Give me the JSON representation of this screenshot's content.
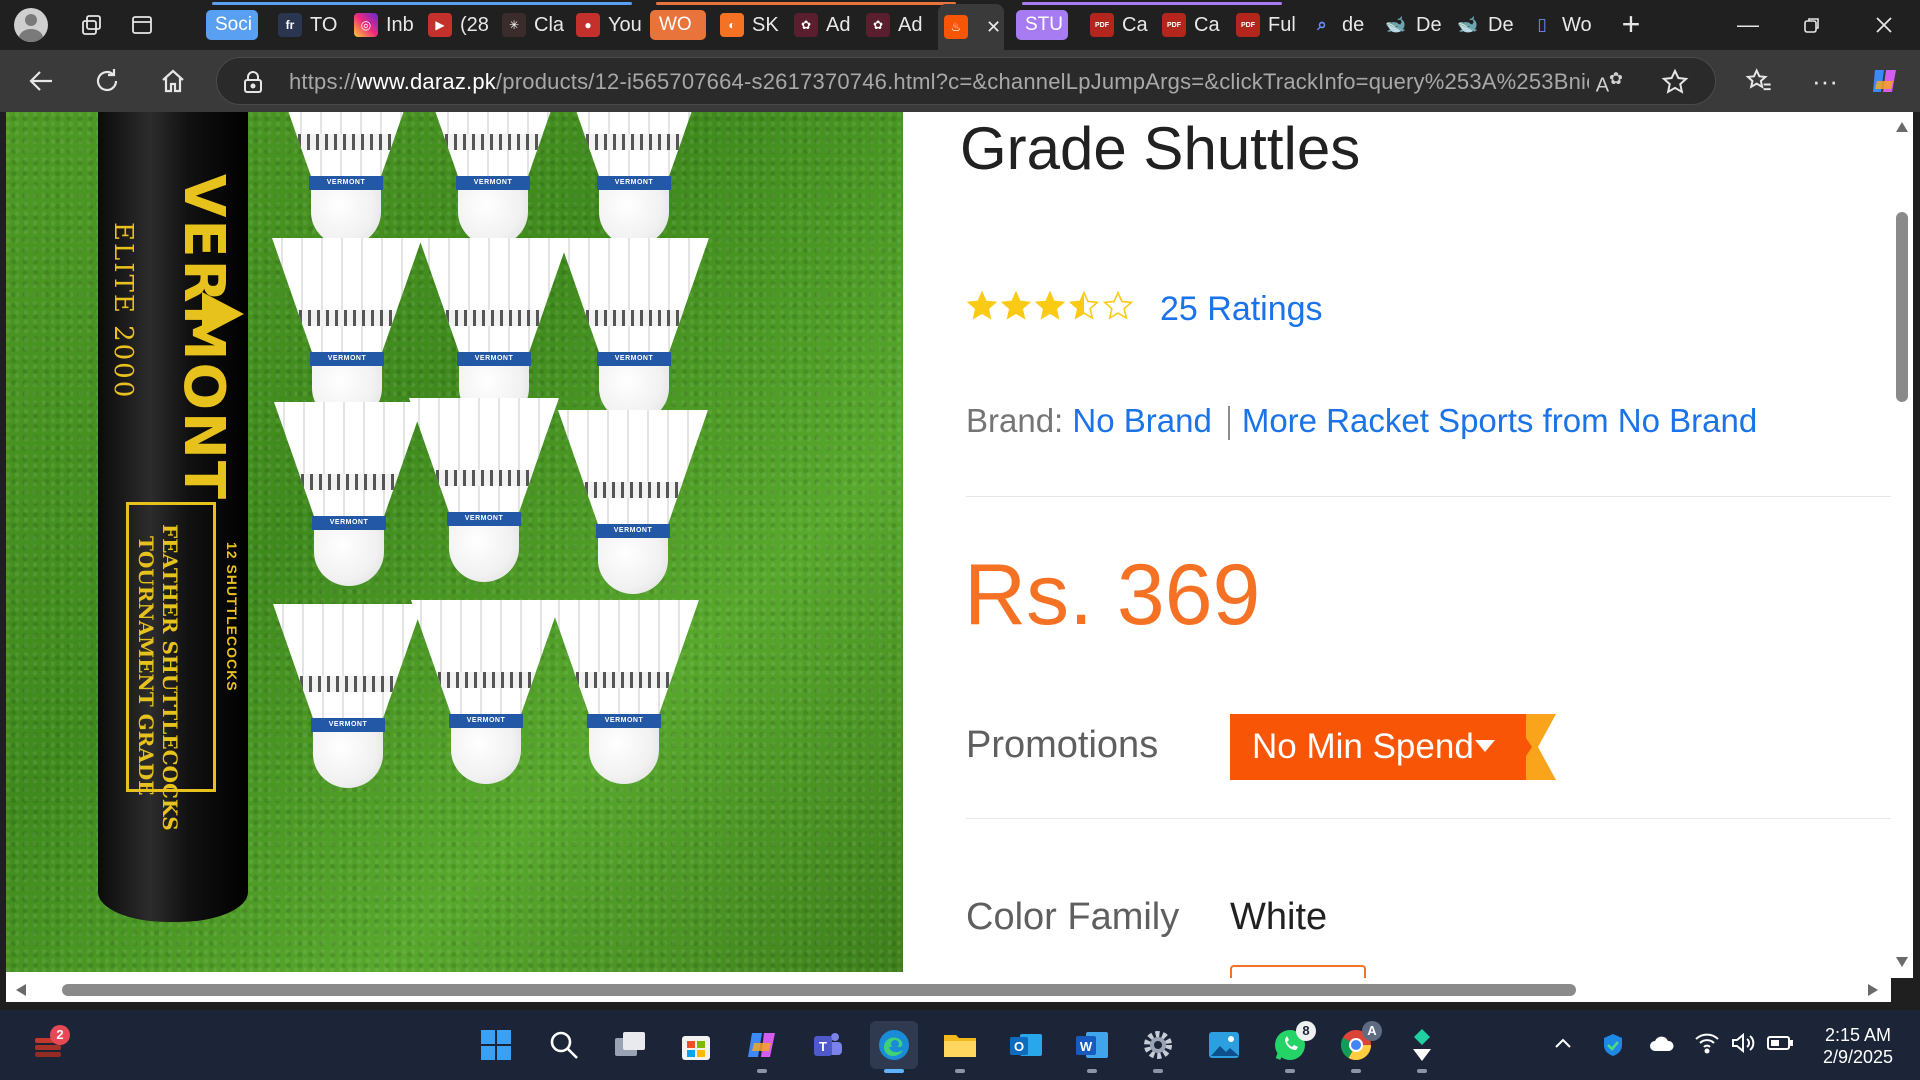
{
  "browser": {
    "tabs": [
      {
        "title": "Soci",
        "favicon": "group-tab",
        "group_color": "#5aa0f2"
      },
      {
        "title": "TO",
        "favicon": "fr-icon"
      },
      {
        "title": "Inb",
        "favicon": "instagram-icon"
      },
      {
        "title": "(28",
        "favicon": "youtube-icon"
      },
      {
        "title": "Cla",
        "favicon": "claude-icon"
      },
      {
        "title": "You",
        "favicon": "youtube-music-icon"
      },
      {
        "title": "WO",
        "favicon": "group-tab",
        "group_color": "#e8743b"
      },
      {
        "title": "SK",
        "favicon": "orange-icon"
      },
      {
        "title": "Ad",
        "favicon": "settings-red-icon"
      },
      {
        "title": "Ad",
        "favicon": "settings-red-icon"
      },
      {
        "title": "",
        "favicon": "daraz-icon",
        "active": true
      },
      {
        "title": "STU",
        "favicon": "group-tab",
        "group_color": "#a77cf2"
      },
      {
        "title": "Ca",
        "favicon": "pdf-icon"
      },
      {
        "title": "Ca",
        "favicon": "pdf-icon"
      },
      {
        "title": "Ful",
        "favicon": "pdf-icon"
      },
      {
        "title": "de",
        "favicon": "search-icon"
      },
      {
        "title": "De",
        "favicon": "deepseek-icon"
      },
      {
        "title": "De",
        "favicon": "deepseek-icon"
      },
      {
        "title": "Wo",
        "favicon": "page-icon"
      }
    ],
    "url_prefix": "https://",
    "url_domain": "www.daraz.pk",
    "url_path": "/products/12-i565707664-s2617370746.html?c=&channelLpJumpArgs=&clickTrackInfo=query%253A%253Bnid%25..."
  },
  "product": {
    "title": "Grade Shuttles",
    "rating_stars": 3.5,
    "ratings_text": "25 Ratings",
    "brand_label": "Brand:",
    "brand_name": "No Brand",
    "brand_more": "More Racket Sports from No Brand",
    "price": "Rs. 369",
    "promotions_label": "Promotions",
    "promotion_tag": "No Min Spend",
    "color_family_label": "Color Family",
    "color_family_value": "White",
    "colors": {
      "price": "#f57224",
      "link": "#1a73e8",
      "promo": "#f85606"
    }
  },
  "image": {
    "tube_brand": "VERMONT",
    "tube_model": "ELITE 2000",
    "tube_desc_1": "FEATHER SHUTTLECOCKS",
    "tube_desc_2": "TOURNAMENT GRADE",
    "tube_count": "12 SHUTTLECOCKS",
    "band_text": "VERMONT"
  },
  "taskbar": {
    "notification_badge": "2",
    "whatsapp_badge": "8",
    "chrome_badge": "A",
    "time": "2:15 AM",
    "date": "2/9/2025"
  }
}
